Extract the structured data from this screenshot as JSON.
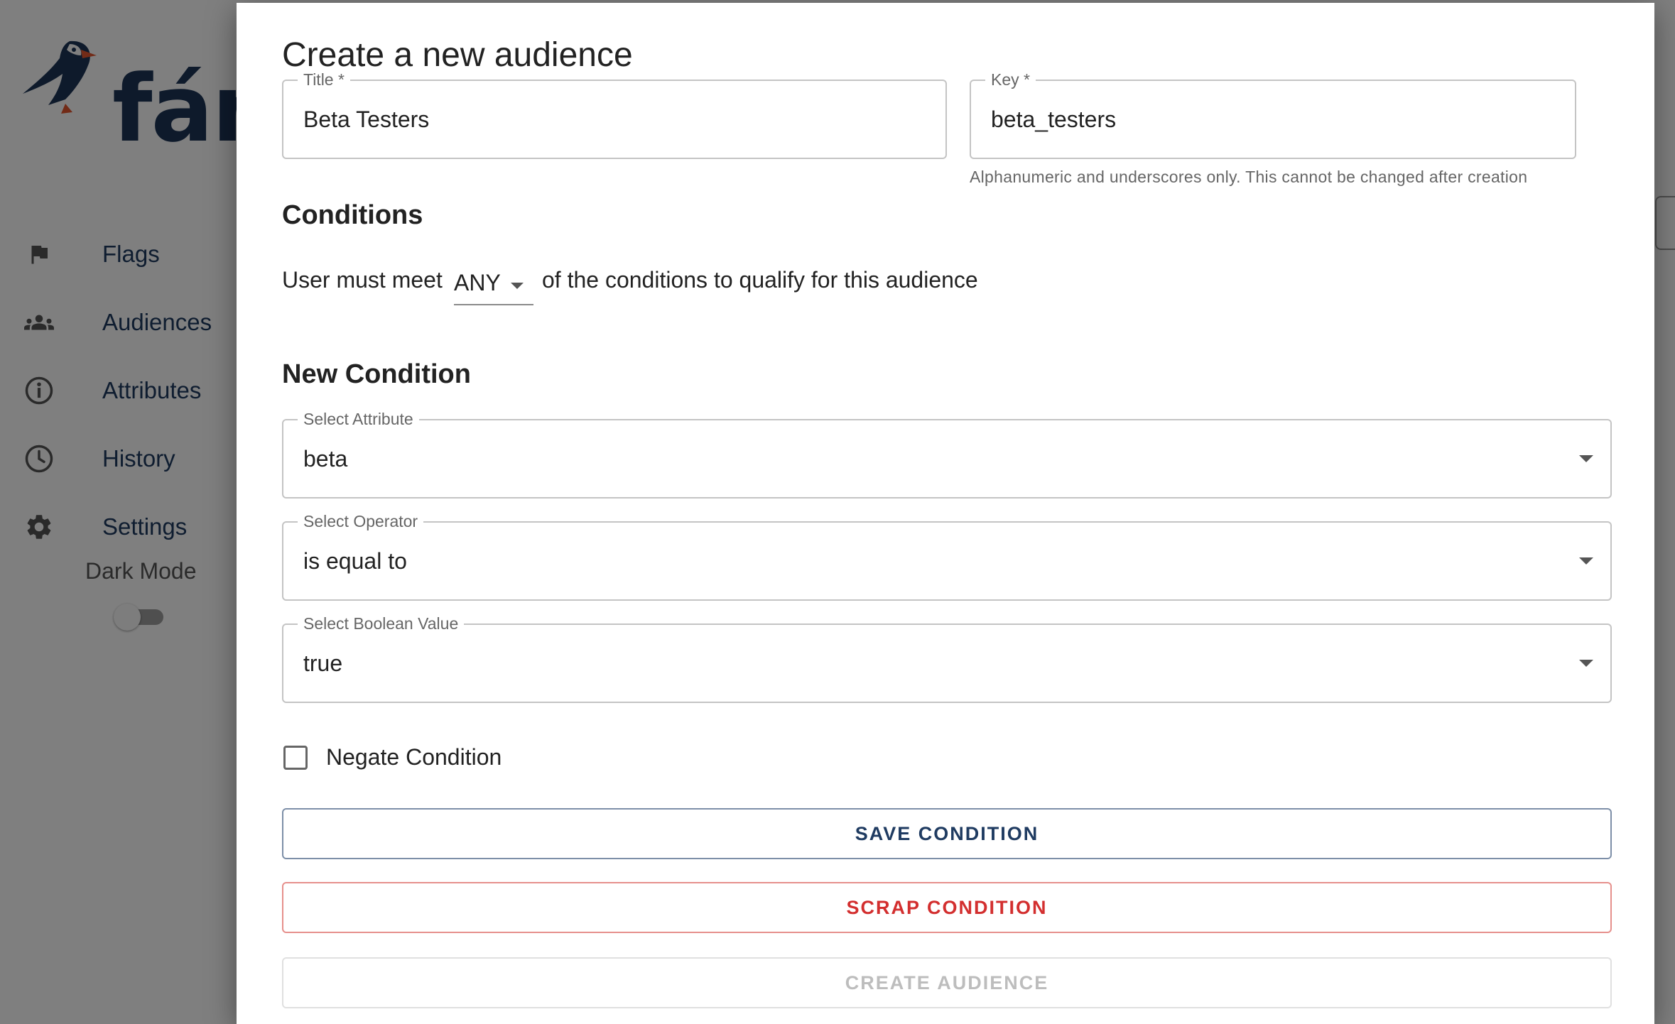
{
  "app": {
    "brand": "fánc",
    "nav": [
      {
        "label": "Flags",
        "icon": "flag-icon"
      },
      {
        "label": "Audiences",
        "icon": "people-icon"
      },
      {
        "label": "Attributes",
        "icon": "info-circle-icon"
      },
      {
        "label": "History",
        "icon": "clock-icon"
      },
      {
        "label": "Settings",
        "icon": "gear-icon"
      }
    ],
    "dark_mode_label": "Dark Mode",
    "dark_mode_on": false
  },
  "dialog": {
    "title": "Create a new audience",
    "title_field": {
      "legend": "Title *",
      "value": "Beta Testers"
    },
    "key_field": {
      "legend": "Key *",
      "value": "beta_testers",
      "helper": "Alphanumeric and underscores only. This cannot be changed after creation"
    },
    "conditions_heading": "Conditions",
    "match_prefix": "User must meet",
    "match_value": "ANY",
    "match_suffix": "of the conditions to qualify for this audience",
    "new_condition_heading": "New Condition",
    "attribute_select": {
      "legend": "Select Attribute",
      "value": "beta"
    },
    "operator_select": {
      "legend": "Select Operator",
      "value": "is equal to"
    },
    "boolean_select": {
      "legend": "Select Boolean Value",
      "value": "true"
    },
    "negate_label": "Negate Condition",
    "negate_checked": false,
    "save_button": "SAVE CONDITION",
    "scrap_button": "SCRAP CONDITION",
    "create_button": "CREATE AUDIENCE"
  },
  "colors": {
    "brand_navy": "#1f3b61",
    "danger": "#d32f2f",
    "disabled": "#bdbdbd"
  }
}
